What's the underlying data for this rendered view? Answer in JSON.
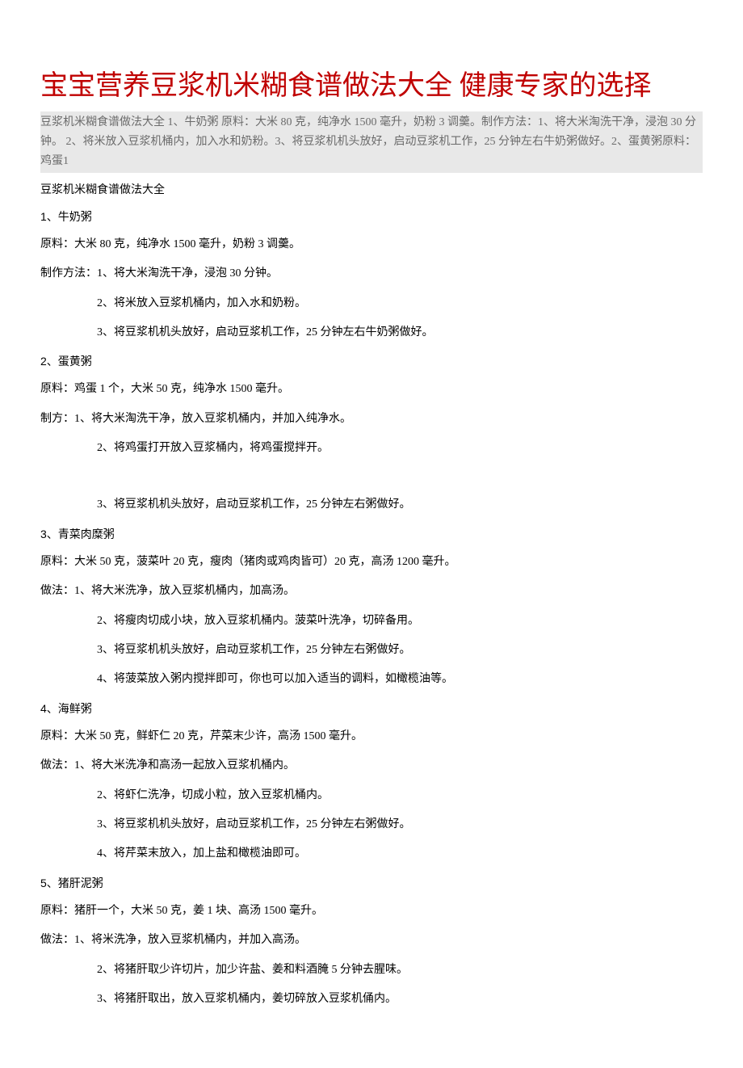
{
  "title": "宝宝营养豆浆机米糊食谱做法大全 健康专家的选择",
  "intro": "豆浆机米糊食谱做法大全 1、牛奶粥 原料：大米 80 克，纯净水 1500 毫升，奶粉 3 调羹。制作方法：1、将大米淘洗干净，浸泡 30 分钟。 2、将米放入豆浆机桶内，加入水和奶粉。3、将豆浆机机头放好，启动豆浆机工作，25 分钟左右牛奶粥做好。2、蛋黄粥原料：鸡蛋1",
  "section_header": "豆浆机米糊食谱做法大全",
  "recipes": [
    {
      "name": "1、牛奶粥",
      "ingredients": "原料：大米 80 克，纯净水 1500 毫升，奶粉 3 调羹。",
      "method_label": "制作方法：",
      "steps": [
        "1、将大米淘洗干净，浸泡 30 分钟。",
        "2、将米放入豆浆机桶内，加入水和奶粉。",
        "3、将豆浆机机头放好，启动豆浆机工作，25 分钟左右牛奶粥做好。"
      ]
    },
    {
      "name": "2、蛋黄粥",
      "ingredients": "原料：鸡蛋 1 个，大米 50 克，纯净水 1500 毫升。",
      "method_label": "制方：",
      "steps": [
        "1、将大米淘洗干净，放入豆浆机桶内，并加入纯净水。",
        "2、将鸡蛋打开放入豆浆桶内，将鸡蛋搅拌开。",
        "3、将豆浆机机头放好，启动豆浆机工作，25 分钟左右粥做好。"
      ]
    },
    {
      "name": "3、青菜肉糜粥",
      "ingredients": "原料：大米 50 克，菠菜叶 20 克，瘦肉（猪肉或鸡肉皆可）20 克，高汤 1200 毫升。",
      "method_label": "做法：",
      "steps": [
        "1、将大米洗净，放入豆浆机桶内，加高汤。",
        "2、将瘦肉切成小块，放入豆浆机桶内。菠菜叶洗净，切碎备用。",
        "3、将豆浆机机头放好，启动豆浆机工作，25 分钟左右粥做好。",
        "4、将菠菜放入粥内搅拌即可，你也可以加入适当的调料，如橄榄油等。"
      ]
    },
    {
      "name": " 4、海鲜粥",
      "ingredients": "原料：大米 50 克，鲜虾仁 20 克，芹菜末少许，高汤 1500 毫升。",
      "method_label": "做法：",
      "steps": [
        "1、将大米洗净和高汤一起放入豆浆机桶内。",
        "2、将虾仁洗净，切成小粒，放入豆浆机桶内。",
        "3、将豆浆机机头放好，启动豆浆机工作，25 分钟左右粥做好。",
        "4、将芹菜末放入，加上盐和橄榄油即可。"
      ]
    },
    {
      "name": "5、猪肝泥粥",
      "ingredients": "原料：猪肝一个，大米 50 克，姜 1 块、高汤 1500 毫升。",
      "method_label": "做法：",
      "steps": [
        "1、将米洗净，放入豆浆机桶内，并加入高汤。",
        "2、将猪肝取少许切片，加少许盐、姜和料酒腌 5 分钟去腥味。",
        "3、将猪肝取出，放入豆浆机桶内，姜切碎放入豆浆机俑内。"
      ]
    }
  ]
}
